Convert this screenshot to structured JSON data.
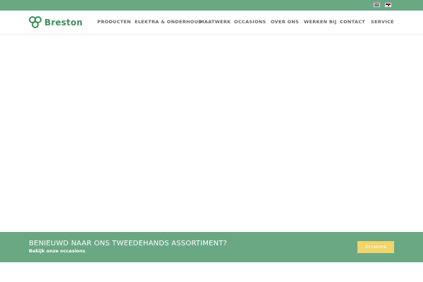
{
  "languages": [
    {
      "code": "nl",
      "label": "Nederlands"
    },
    {
      "code": "en",
      "label": "English"
    }
  ],
  "logo": {
    "text": "Breston"
  },
  "nav": {
    "items": [
      {
        "label": "PRODUCTEN"
      },
      {
        "label": "ELEKTRA & ONDERHOUD"
      },
      {
        "label": "MAATWERK"
      },
      {
        "label": "OCCASIONS"
      },
      {
        "label": "OVER ONS"
      },
      {
        "label": "WERKEN BIJ"
      },
      {
        "label": "CONTACT"
      },
      {
        "label": "SERVICE"
      }
    ]
  },
  "banner": {
    "title": "BENIEUWD NAAR ONS TWEEDEHANDS ASSORTIMENT?",
    "subtitle": "Bekijk onze occasions",
    "button_label": "Occasions"
  },
  "colors": {
    "brand_green": "#6aa884",
    "logo_green": "#3f8e5a",
    "button_yellow": "#f1d46a"
  }
}
